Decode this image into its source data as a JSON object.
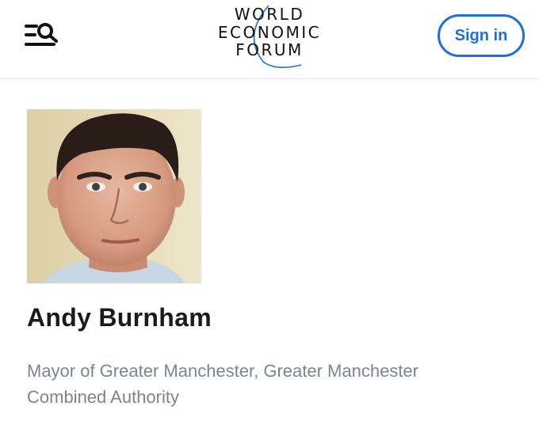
{
  "header": {
    "menu_icon": "menu-search-icon",
    "logo": {
      "line1": "WORLD",
      "line2": "ECONOMIC",
      "line3": "FORUM"
    },
    "signin_label": "Sign in"
  },
  "profile": {
    "name": "Andy Burnham",
    "role": "Mayor of Greater Manchester, Greater Manchester Combined Authority"
  },
  "colors": {
    "accent": "#1f6de0",
    "role_text": "#7c858f",
    "name_text": "#1b1b1b"
  }
}
